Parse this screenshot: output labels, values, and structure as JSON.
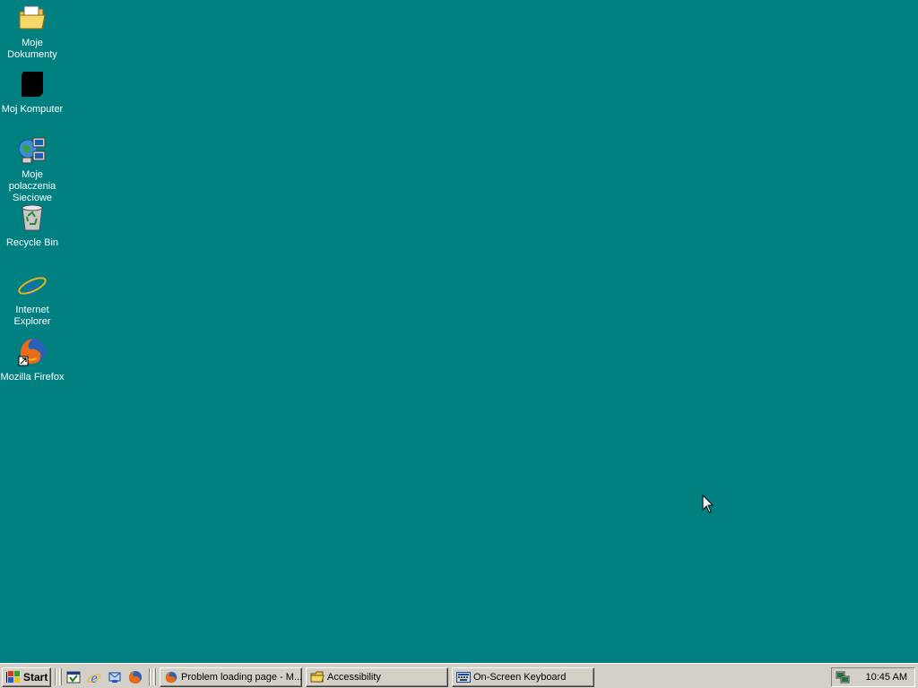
{
  "desktop": {
    "icons": [
      {
        "label": "Moje\nDokumenty",
        "icon": "my-documents-icon"
      },
      {
        "label": "Moj Komputer",
        "icon": "my-computer-icon"
      },
      {
        "label": "Moje\npolaczenia\nSieciowe",
        "icon": "network-places-icon"
      },
      {
        "label": "Recycle Bin",
        "icon": "recycle-bin-icon"
      },
      {
        "label": "Internet\nExplorer",
        "icon": "internet-explorer-icon"
      },
      {
        "label": "Mozilla Firefox",
        "icon": "firefox-icon"
      }
    ]
  },
  "taskbar": {
    "start_label": "Start",
    "quick_launch": [
      "show-desktop-icon",
      "internet-explorer-icon",
      "outlook-express-icon",
      "firefox-icon"
    ],
    "tasks": [
      {
        "label": "Problem loading page - M...",
        "icon": "firefox-icon"
      },
      {
        "label": "Accessibility",
        "icon": "folder-icon"
      },
      {
        "label": "On-Screen Keyboard",
        "icon": "keyboard-icon"
      }
    ],
    "tray": {
      "icon": "network-tray-icon",
      "clock": "10:45 AM"
    }
  },
  "colors": {
    "desktop_bg": "#008080",
    "taskbar_bg": "#d4d0c8"
  }
}
